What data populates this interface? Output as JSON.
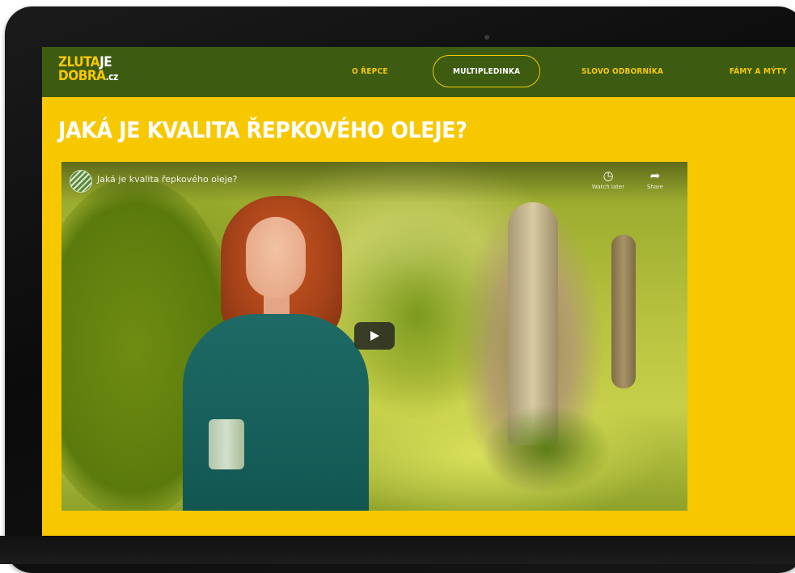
{
  "logo": {
    "line1_yellow": "ZLUTA",
    "line1_white": "JE",
    "line2_yellow": "DOBRA",
    "line2_suffix": ".cz"
  },
  "nav": {
    "items": [
      {
        "label": "O ŘEPCE",
        "active": false
      },
      {
        "label": "MULTIPLEDINKA",
        "active": true
      },
      {
        "label": "SLOVO ODBORNÍKA",
        "active": false
      },
      {
        "label": "FÁMY A MÝTY",
        "active": false
      }
    ]
  },
  "page": {
    "headline": "JAKÁ JE KVALITA ŘEPKOVÉHO OLEJE?"
  },
  "video": {
    "title": "Jaká je kvalita řepkového oleje?",
    "watch_later_label": "Watch later",
    "share_label": "Share",
    "play_icon": "play-icon"
  },
  "colors": {
    "brand_yellow": "#f7c800",
    "brand_green": "#3d5c12"
  }
}
